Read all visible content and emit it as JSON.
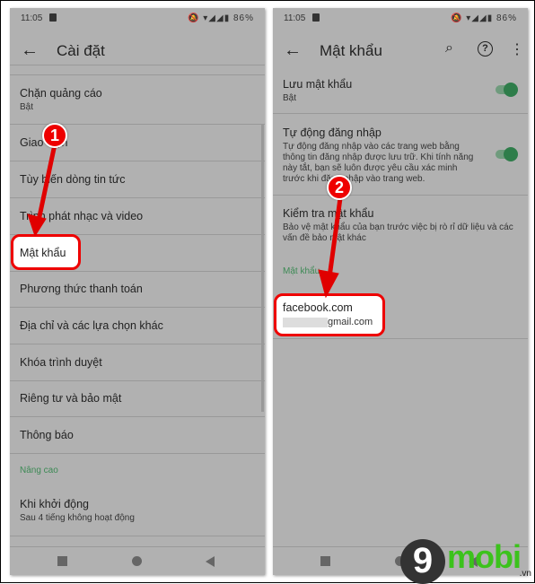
{
  "status": {
    "time": "11:05",
    "battery": "86%",
    "icons": [
      "bell-off-icon",
      "volte-icon",
      "wifi-icon",
      "signal-icon",
      "signal-icon",
      "battery-icon"
    ]
  },
  "left": {
    "title": "Cài đặt",
    "items": [
      {
        "label": "Chặn quảng cáo",
        "sub": "Bật"
      },
      {
        "label": "Giao diện"
      },
      {
        "label": "Tùy biến dòng tin tức"
      },
      {
        "label": "Trình phát nhạc và video"
      },
      {
        "label": "Mật khẩu"
      },
      {
        "label": "Phương thức thanh toán"
      },
      {
        "label": "Địa chỉ và các lựa chọn khác"
      },
      {
        "label": "Khóa trình duyệt"
      },
      {
        "label": "Riêng tư và bảo mật"
      },
      {
        "label": "Thông báo"
      }
    ],
    "section": "Nâng cao",
    "startup": {
      "label": "Khi khởi động",
      "sub": "Sau 4 tiếng không hoạt động"
    }
  },
  "right": {
    "title": "Mật khẩu",
    "save": {
      "label": "Lưu mật khẩu",
      "sub": "Bật",
      "on": true
    },
    "autologin": {
      "label": "Tự động đăng nhập",
      "sub": "Tự động đăng nhập vào các trang web bằng thông tin đăng nhập được lưu trữ. Khi tính năng này tắt, bạn sẽ luôn được yêu cầu xác minh trước khi đăng nhập vào trang web.",
      "on": true
    },
    "check": {
      "label": "Kiểm tra mật khẩu",
      "sub": "Bảo vệ mật khẩu của bạn trước việc bị rò rỉ dữ liệu và các vấn đề bảo mật khác"
    },
    "section": "Mật khẩu",
    "entry": {
      "site": "facebook.com",
      "email": "gmail.com"
    }
  },
  "annotations": {
    "step1": "1",
    "step2": "2",
    "color": "#e00000"
  },
  "watermark": {
    "text": "9mobi",
    "suffix": ".vn"
  }
}
